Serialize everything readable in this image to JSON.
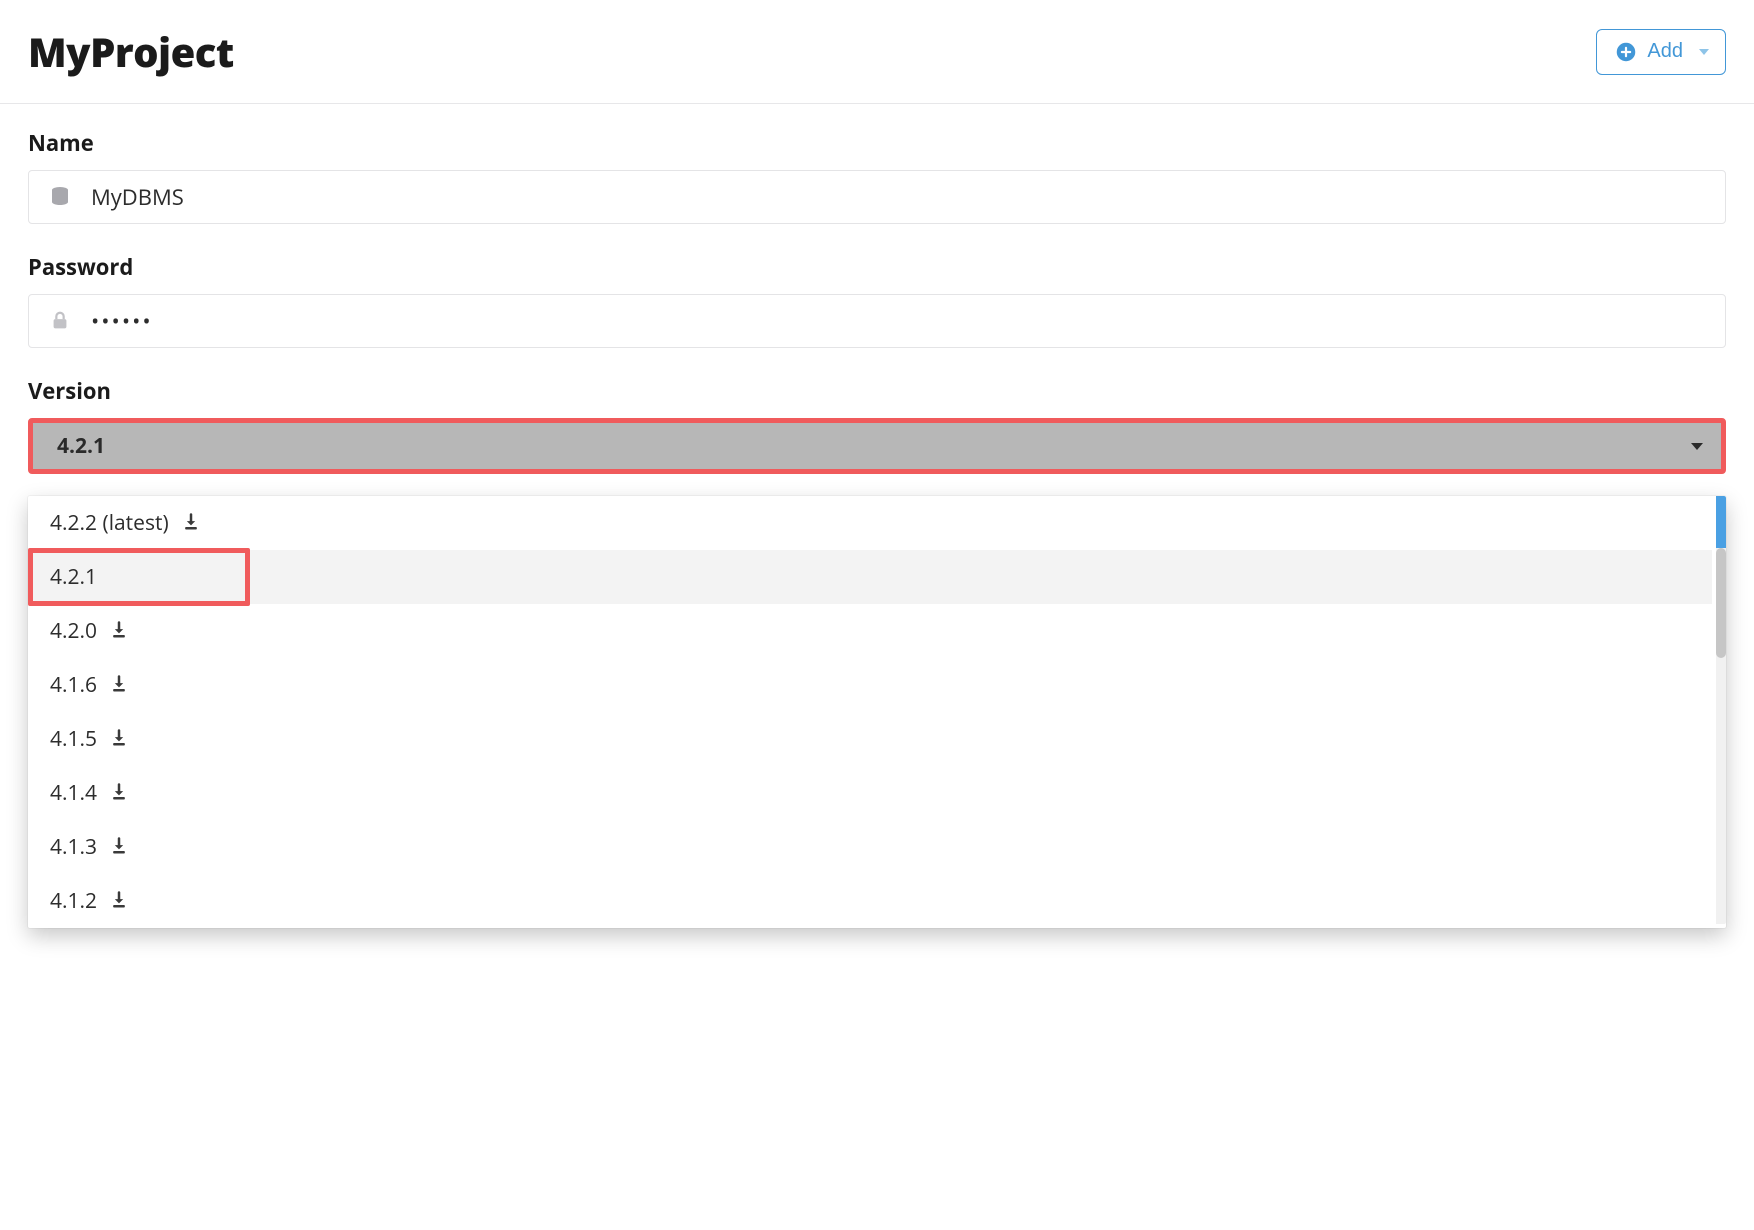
{
  "header": {
    "title": "MyProject",
    "add_label": "Add"
  },
  "form": {
    "name_label": "Name",
    "name_value": "MyDBMS",
    "password_label": "Password",
    "password_value": "••••••",
    "version_label": "Version",
    "version_selected": "4.2.1"
  },
  "version_options": [
    {
      "label": "4.2.2 (latest)",
      "download": true,
      "selected": false
    },
    {
      "label": "4.2.1",
      "download": false,
      "selected": true
    },
    {
      "label": "4.2.0",
      "download": true,
      "selected": false
    },
    {
      "label": "4.1.6",
      "download": true,
      "selected": false
    },
    {
      "label": "4.1.5",
      "download": true,
      "selected": false
    },
    {
      "label": "4.1.4",
      "download": true,
      "selected": false
    },
    {
      "label": "4.1.3",
      "download": true,
      "selected": false
    },
    {
      "label": "4.1.2",
      "download": true,
      "selected": false
    }
  ],
  "colors": {
    "accent": "#4297d7",
    "highlight": "#f05b5c"
  }
}
